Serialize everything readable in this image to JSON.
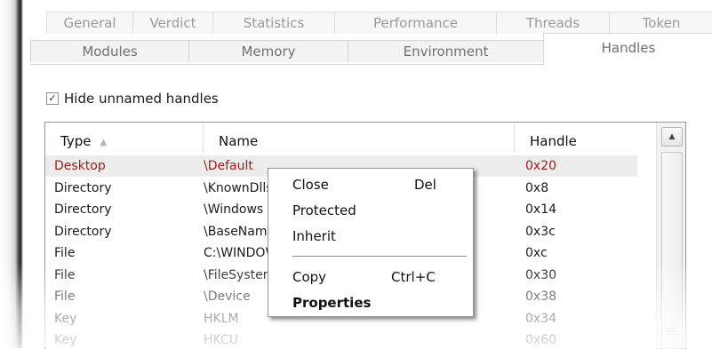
{
  "tabs": {
    "row1": [
      "General",
      "Verdict",
      "Statistics",
      "Performance",
      "Threads",
      "Token"
    ],
    "row2": [
      "Modules",
      "Memory",
      "Environment",
      "Handles"
    ],
    "active": "Handles"
  },
  "options": {
    "hide_unnamed_label": "Hide unnamed handles",
    "hide_unnamed_checked": true,
    "check_glyph": "✓"
  },
  "table": {
    "columns": [
      "Type",
      "Name",
      "Handle"
    ],
    "sort_column": "Type",
    "sort_direction": "ascending",
    "sort_glyph": "▲",
    "rows": [
      {
        "type": "Desktop",
        "name": "\\Default",
        "handle": "0x20",
        "selected": true
      },
      {
        "type": "Directory",
        "name": "\\KnownDlls",
        "handle": "0x8"
      },
      {
        "type": "Directory",
        "name": "\\Windows",
        "handle": "0x14"
      },
      {
        "type": "Directory",
        "name": "\\BaseNamedObjects",
        "handle": "0x3c"
      },
      {
        "type": "File",
        "name": "C:\\WINDOWS",
        "handle": "0xc"
      },
      {
        "type": "File",
        "name": "\\FileSystem",
        "handle": "0x30"
      },
      {
        "type": "File",
        "name": "\\Device",
        "handle": "0x38"
      },
      {
        "type": "Key",
        "name": "HKLM",
        "handle": "0x34"
      },
      {
        "type": "Key",
        "name": "HKCU",
        "handle": "0x60"
      }
    ]
  },
  "scrollbar": {
    "up_glyph": "▲"
  },
  "context_menu": {
    "items": [
      {
        "label": "Close",
        "shortcut": "Del"
      },
      {
        "label": "Protected"
      },
      {
        "label": "Inherit"
      },
      {
        "separator": true
      },
      {
        "label": "Copy",
        "shortcut": "Ctrl+C"
      },
      {
        "label": "Properties",
        "bold": true
      }
    ]
  },
  "colors": {
    "selected_text": "#9b1b1b",
    "row_text": "#1a1a1a",
    "selected_row_bg": "#ececec",
    "list_border": "#8a9aaa"
  }
}
